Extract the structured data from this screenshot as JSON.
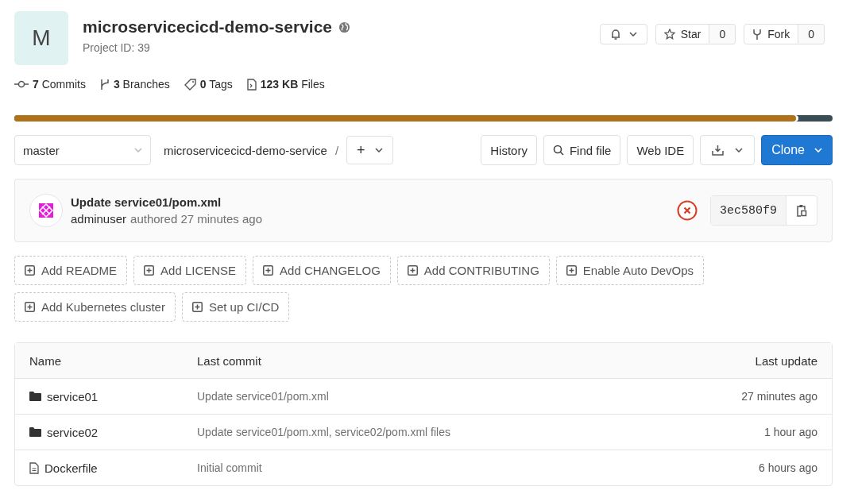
{
  "project": {
    "avatar_letter": "M",
    "name": "microservicecicd-demo-service",
    "project_id": "Project ID: 39"
  },
  "header_actions": {
    "star_label": "Star",
    "star_count": "0",
    "fork_label": "Fork",
    "fork_count": "0"
  },
  "stats": [
    {
      "kind": "commits",
      "count": "7",
      "label": "Commits"
    },
    {
      "kind": "branches",
      "count": "3",
      "label": "Branches"
    },
    {
      "kind": "tags",
      "count": "0",
      "label": "Tags"
    },
    {
      "kind": "files",
      "count": "123 KB",
      "label": "Files"
    }
  ],
  "language_bar": {
    "level": 0.955
  },
  "toolbar": {
    "branch": "master",
    "path": "microservicecicd-demo-service",
    "separator": "/",
    "add": "+",
    "buttons": [
      "History",
      "Find file",
      "Web IDE"
    ],
    "clone": "Clone"
  },
  "last_commit": {
    "title": "Update service01/pom.xml",
    "author": "adminuser",
    "meta": "authored 27 minutes ago",
    "pipeline_failed": true,
    "sha": "3ec580f9"
  },
  "shortcuts": [
    "Add README",
    "Add LICENSE",
    "Add CHANGELOG",
    "Add CONTRIBUTING",
    "Enable Auto DevOps",
    "Add Kubernetes cluster",
    "Set up CI/CD"
  ],
  "table": {
    "columns": [
      "Name",
      "Last commit",
      "Last update"
    ],
    "rows": [
      {
        "kind": "folder",
        "name": "service01",
        "commit": "Update service01/pom.xml",
        "updated": "27 minutes ago"
      },
      {
        "kind": "folder",
        "name": "service02",
        "commit": "Update service01/pom.xml, service02/pom.xml files",
        "updated": "1 hour ago"
      },
      {
        "kind": "file",
        "name": "Dockerfile",
        "commit": "Initial commit",
        "updated": "6 hours ago"
      }
    ]
  }
}
